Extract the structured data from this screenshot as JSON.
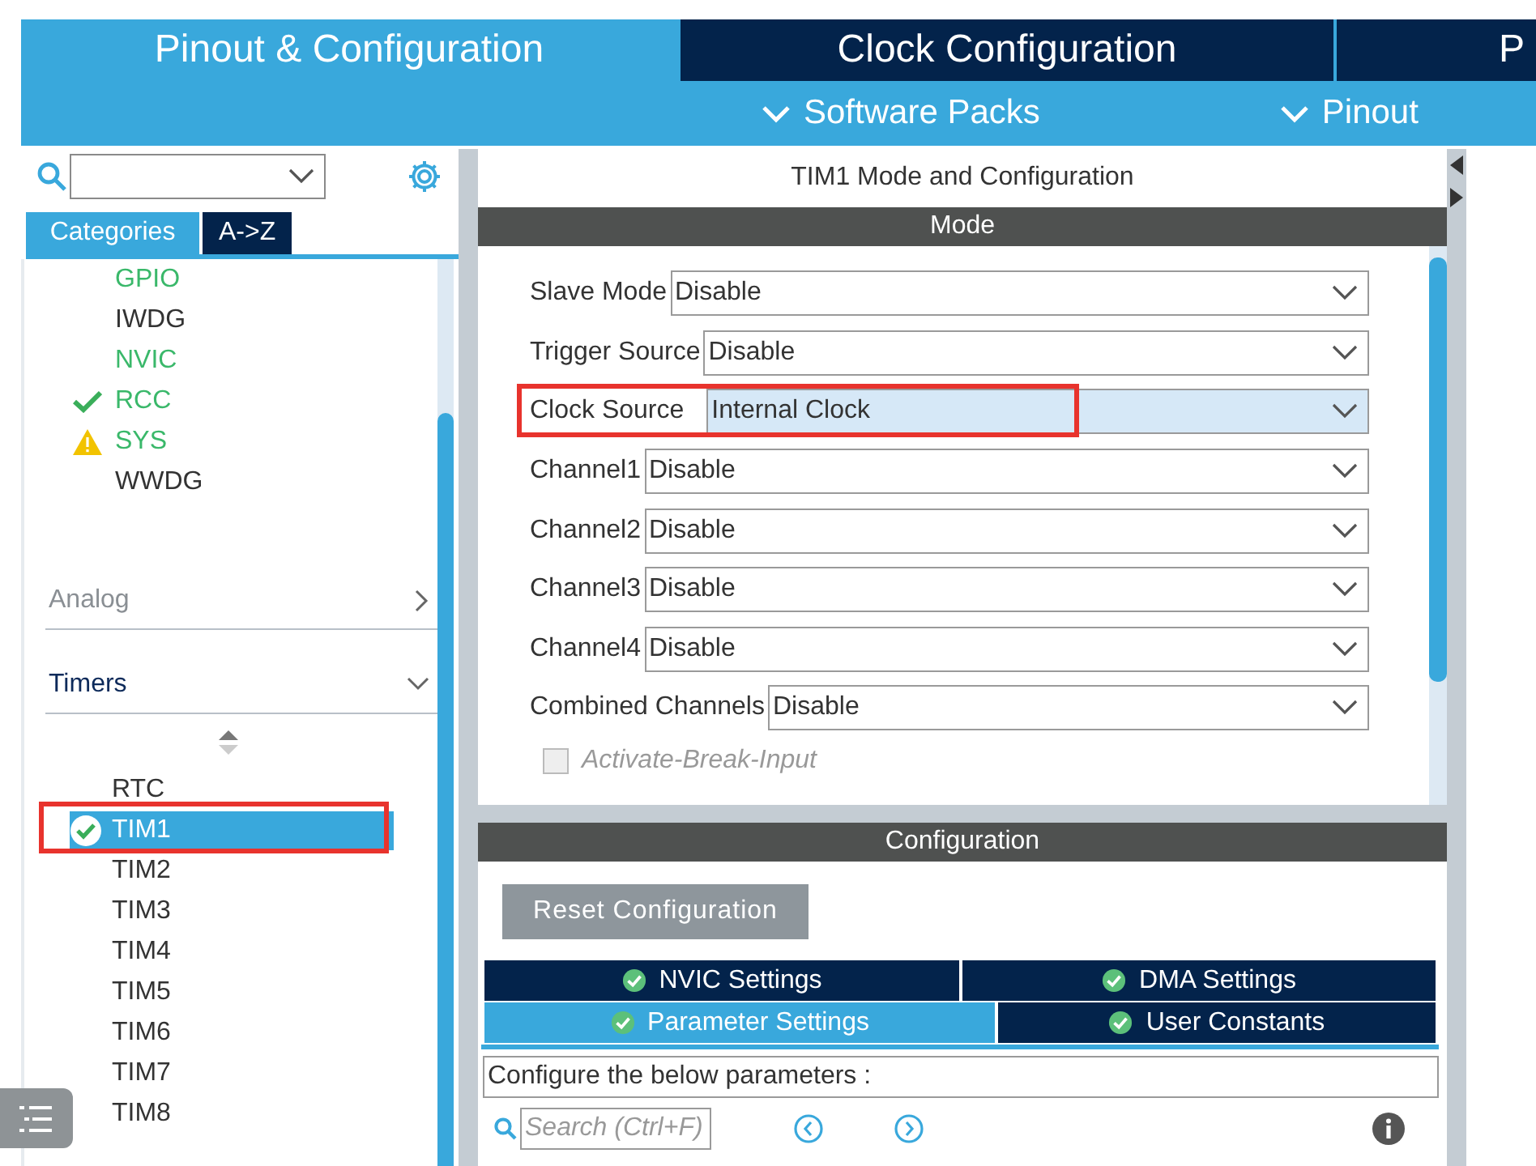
{
  "top_tabs": [
    {
      "label": "Pinout & Configuration",
      "selected": true
    },
    {
      "label": "Clock Configuration",
      "selected": false
    },
    {
      "label": "P",
      "selected": false
    }
  ],
  "menus": [
    {
      "label": "Software Packs"
    },
    {
      "label": "Pinout"
    }
  ],
  "sidebar": {
    "category_tabs": [
      {
        "label": "Categories",
        "selected": true
      },
      {
        "label": "A->Z",
        "selected": false
      }
    ],
    "items": [
      {
        "label": "GPIO",
        "active": true,
        "configured": false,
        "warning": false
      },
      {
        "label": "IWDG",
        "active": false,
        "configured": false,
        "warning": false
      },
      {
        "label": "NVIC",
        "active": true,
        "configured": false,
        "warning": false
      },
      {
        "label": "RCC",
        "active": true,
        "configured": true,
        "warning": false
      },
      {
        "label": "SYS",
        "active": true,
        "configured": false,
        "warning": true
      },
      {
        "label": "WWDG",
        "active": false,
        "configured": false,
        "warning": false
      }
    ],
    "groups": [
      {
        "label": "Analog",
        "expanded": false
      },
      {
        "label": "Timers",
        "expanded": true,
        "children": [
          {
            "label": "RTC",
            "selected": false,
            "configured": false,
            "highlighted": false
          },
          {
            "label": "TIM1",
            "selected": true,
            "configured": true,
            "highlighted": true
          },
          {
            "label": "TIM2",
            "selected": false,
            "configured": false,
            "highlighted": false
          },
          {
            "label": "TIM3",
            "selected": false,
            "configured": false,
            "highlighted": false
          },
          {
            "label": "TIM4",
            "selected": false,
            "configured": false,
            "highlighted": false
          },
          {
            "label": "TIM5",
            "selected": false,
            "configured": false,
            "highlighted": false
          },
          {
            "label": "TIM6",
            "selected": false,
            "configured": false,
            "highlighted": false
          },
          {
            "label": "TIM7",
            "selected": false,
            "configured": false,
            "highlighted": false
          },
          {
            "label": "TIM8",
            "selected": false,
            "configured": false,
            "highlighted": false
          }
        ]
      }
    ]
  },
  "mode_panel": {
    "title": "TIM1 Mode and Configuration",
    "header": "Mode",
    "fields": [
      {
        "label": "Slave Mode",
        "value": "Disable",
        "highlighted": false
      },
      {
        "label": "Trigger Source",
        "value": "Disable",
        "highlighted": false
      },
      {
        "label": "Clock Source",
        "value": "Internal Clock",
        "highlighted": true
      },
      {
        "label": "Channel1",
        "value": "Disable",
        "highlighted": false
      },
      {
        "label": "Channel2",
        "value": "Disable",
        "highlighted": false
      },
      {
        "label": "Channel3",
        "value": "Disable",
        "highlighted": false
      },
      {
        "label": "Channel4",
        "value": "Disable",
        "highlighted": false
      },
      {
        "label": "Combined Channels",
        "value": "Disable",
        "highlighted": false
      }
    ],
    "checkbox": {
      "label": "Activate-Break-Input",
      "checked": false,
      "disabled": true
    }
  },
  "config_panel": {
    "header": "Configuration",
    "reset_button": "Reset Configuration",
    "tabs": [
      {
        "label": "NVIC Settings",
        "selected": false
      },
      {
        "label": "DMA Settings",
        "selected": false
      },
      {
        "label": "Parameter Settings",
        "selected": true
      },
      {
        "label": "User Constants",
        "selected": false
      }
    ],
    "description": "Configure the below parameters :",
    "search": {
      "placeholder": "Search (Ctrl+F)"
    }
  }
}
